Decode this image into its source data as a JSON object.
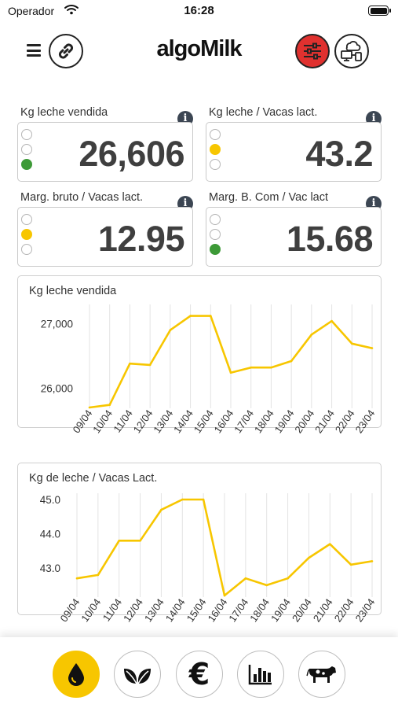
{
  "status_bar": {
    "carrier": "Operador",
    "time": "16:28"
  },
  "header": {
    "logo": "algoMilk"
  },
  "kpis": [
    {
      "label": "Kg leche vendida",
      "value": "26,606",
      "light": "green"
    },
    {
      "label": "Kg leche / Vacas lact.",
      "value": "43.2",
      "light": "yellow"
    },
    {
      "label": "Marg. bruto / Vacas lact.",
      "value": "12.95",
      "light": "yellow"
    },
    {
      "label": "Marg. B. Com / Vac lact",
      "value": "15.68",
      "light": "green"
    }
  ],
  "info_glyph": "i",
  "colors": {
    "line": "#f7c600",
    "alert": "#e0312f",
    "green": "#3d9a37",
    "yellow": "#f7c600"
  },
  "nav": [
    "drop-icon",
    "leaf-icon",
    "euro-icon",
    "bar-chart-icon",
    "cow-icon"
  ],
  "euro_symbol": "€",
  "chart_data": [
    {
      "type": "line",
      "title": "Kg leche vendida",
      "categories": [
        "09/04",
        "10/04",
        "11/04",
        "12/04",
        "13/04",
        "14/04",
        "15/04",
        "16/04",
        "17/04",
        "18/04",
        "19/04",
        "20/04",
        "21/04",
        "22/04",
        "23/04"
      ],
      "values": [
        25700,
        25740,
        26380,
        26360,
        26900,
        27120,
        27120,
        26240,
        26320,
        26320,
        26420,
        26830,
        27040,
        26690,
        26620
      ],
      "ylim": [
        25700,
        27200
      ],
      "yticks": [
        {
          "value": 27000,
          "label": "27,000"
        },
        {
          "value": 26000,
          "label": "26,000"
        }
      ],
      "grid": "vertical"
    },
    {
      "type": "line",
      "title": "Kg de leche / Vacas Lact.",
      "categories": [
        "09/04",
        "10/04",
        "11/04",
        "12/04",
        "13/04",
        "14/04",
        "15/04",
        "16/04",
        "17/04",
        "18/04",
        "19/04",
        "20/04",
        "21/04",
        "22/04",
        "23/04"
      ],
      "values": [
        42.7,
        42.8,
        43.8,
        43.8,
        44.7,
        45.0,
        45.0,
        42.2,
        42.7,
        42.5,
        42.7,
        43.3,
        43.7,
        43.1,
        43.2
      ],
      "ylim": [
        42.2,
        45.0
      ],
      "yticks": [
        {
          "value": 45.0,
          "label": "45.0"
        },
        {
          "value": 44.0,
          "label": "44.0"
        },
        {
          "value": 43.0,
          "label": "43.0"
        }
      ],
      "grid": "vertical"
    }
  ]
}
